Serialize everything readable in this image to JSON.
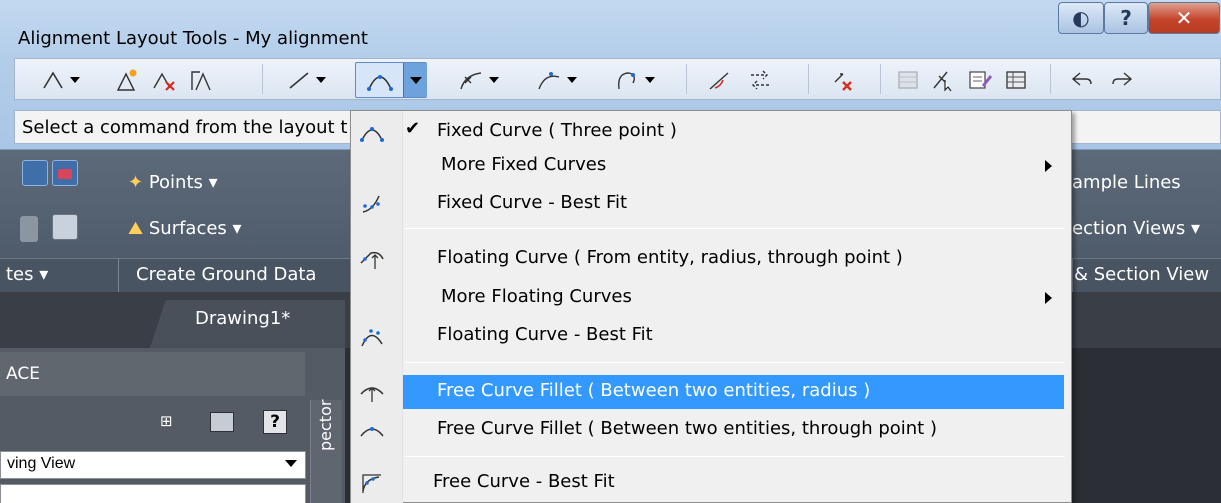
{
  "window": {
    "title": "Alignment Layout Tools - My alignment",
    "prompt": "Select a command from the layout tools toolbar:"
  },
  "menu": {
    "items": [
      {
        "label": "Fixed Curve ( Three point )",
        "checked": true,
        "submenu": false,
        "icon": "fixed-curve-three-point-icon"
      },
      {
        "label": "More Fixed Curves",
        "checked": false,
        "submenu": true,
        "icon": ""
      },
      {
        "label": "Fixed Curve - Best Fit",
        "checked": false,
        "submenu": false,
        "icon": "fixed-curve-best-fit-icon"
      },
      {
        "label": "Floating Curve ( From entity, radius, through point )",
        "checked": false,
        "submenu": false,
        "icon": "floating-curve-icon"
      },
      {
        "label": "More Floating Curves",
        "checked": false,
        "submenu": true,
        "icon": ""
      },
      {
        "label": "Floating Curve - Best Fit",
        "checked": false,
        "submenu": false,
        "icon": "floating-curve-best-fit-icon"
      },
      {
        "label": "Free Curve Fillet ( Between two entities, radius )",
        "checked": false,
        "submenu": false,
        "highlighted": true,
        "icon": "free-curve-fillet-radius-icon"
      },
      {
        "label": "Free Curve Fillet ( Between two entities, through point )",
        "checked": false,
        "submenu": false,
        "icon": "free-curve-fillet-point-icon"
      },
      {
        "label": "Free Curve - Best Fit",
        "checked": false,
        "submenu": false,
        "icon": "free-curve-best-fit-icon"
      }
    ],
    "check_mark": "✔",
    "highlight_color": "#3399ff"
  },
  "ribbon": {
    "points": "Points",
    "surfaces": "Surfaces",
    "tes": "tes",
    "create_ground_data": "Create Ground Data",
    "ample_lines": "ample Lines",
    "ection_views": "ection Views",
    "section_view": "& Section View",
    "dropdown_glyph": "▾"
  },
  "tabs": {
    "drawing": "Drawing1*"
  },
  "toolspace": {
    "title": "ACE",
    "view_select": "ving View",
    "prospector": "pector"
  }
}
